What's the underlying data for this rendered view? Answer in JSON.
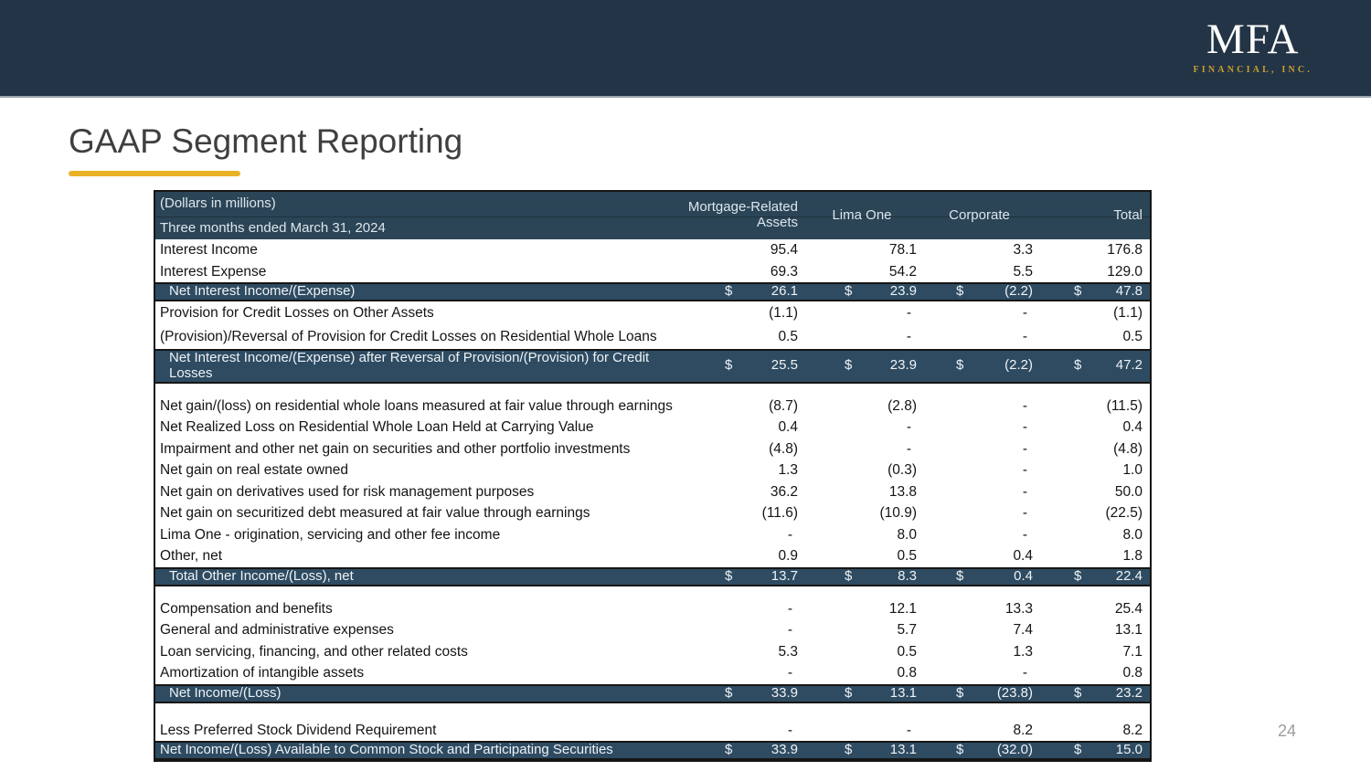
{
  "banner": {
    "logo": {
      "main": "MFA",
      "sub": "FINANCIAL, INC."
    }
  },
  "slide": {
    "title": "GAAP Segment Reporting",
    "page_number": "24"
  },
  "colors": {
    "banner_bg": "#233447",
    "table_header_bg": "#2b4557",
    "highlight_row_bg": "#2e4b61",
    "accent_gold": "#e9b125",
    "logo_gold": "#c9a02b",
    "title_text": "#3f3f3f",
    "page_number_text": "#9c9c9c"
  },
  "table": {
    "currency_symbol": "$",
    "header": {
      "label_line1": "(Dollars in millions)",
      "label_line2": "Three months ended March 31, 2024",
      "columns": [
        "Mortgage-Related Assets",
        "Lima One",
        "Corporate",
        "Total"
      ]
    },
    "rows": [
      {
        "type": "normal",
        "label": "Interest Income",
        "values": [
          "95.4",
          "78.1",
          "3.3",
          "176.8"
        ]
      },
      {
        "type": "normal",
        "label": "Interest Expense",
        "values": [
          "69.3",
          "54.2",
          "5.5",
          "129.0"
        ]
      },
      {
        "type": "highlight",
        "indent": true,
        "dollar": true,
        "label": "Net Interest Income/(Expense)",
        "values": [
          "26.1",
          "23.9",
          "(2.2)",
          "47.8"
        ]
      },
      {
        "type": "normal",
        "tall": true,
        "label": "Provision for Credit Losses on Other Assets",
        "values": [
          "(1.1)",
          "-",
          "-",
          "(1.1)"
        ]
      },
      {
        "type": "normal",
        "tall": true,
        "label": "(Provision)/Reversal of Provision for Credit Losses on Residential Whole Loans",
        "values": [
          "0.5",
          "-",
          "-",
          "0.5"
        ]
      },
      {
        "type": "highlight",
        "indent": true,
        "dollar": true,
        "label": "Net Interest Income/(Expense) after Reversal of Provision/(Provision) for Credit Losses",
        "values": [
          "25.5",
          "23.9",
          "(2.2)",
          "47.2"
        ]
      },
      {
        "type": "blank"
      },
      {
        "type": "normal",
        "label": "Net gain/(loss) on residential whole loans measured at fair value through earnings",
        "values": [
          "(8.7)",
          "(2.8)",
          "-",
          "(11.5)"
        ]
      },
      {
        "type": "normal",
        "label": "Net Realized Loss on Residential Whole Loan Held at Carrying Value",
        "values": [
          "0.4",
          "-",
          "-",
          "0.4"
        ]
      },
      {
        "type": "normal",
        "label": "Impairment and other net gain on securities and other portfolio investments",
        "values": [
          "(4.8)",
          "-",
          "-",
          "(4.8)"
        ]
      },
      {
        "type": "normal",
        "label": "Net gain on real estate owned",
        "values": [
          "1.3",
          "(0.3)",
          "-",
          "1.0"
        ]
      },
      {
        "type": "normal",
        "label": "Net gain on derivatives used for risk management purposes",
        "values": [
          "36.2",
          "13.8",
          "-",
          "50.0"
        ]
      },
      {
        "type": "normal",
        "label": "Net gain on securitized debt measured at fair value through earnings",
        "values": [
          "(11.6)",
          "(10.9)",
          "-",
          "(22.5)"
        ]
      },
      {
        "type": "normal",
        "label": "Lima One - origination, servicing and other fee income",
        "values": [
          "-",
          "8.0",
          "-",
          "8.0"
        ]
      },
      {
        "type": "normal",
        "label": "Other, net",
        "values": [
          "0.9",
          "0.5",
          "0.4",
          "1.8"
        ]
      },
      {
        "type": "highlight",
        "indent": true,
        "dollar": true,
        "label": "Total Other Income/(Loss), net",
        "values": [
          "13.7",
          "8.3",
          "0.4",
          "22.4"
        ]
      },
      {
        "type": "blank"
      },
      {
        "type": "normal",
        "label": "Compensation and benefits",
        "values": [
          "-",
          "12.1",
          "13.3",
          "25.4"
        ]
      },
      {
        "type": "normal",
        "label": "General and administrative expenses",
        "values": [
          "-",
          "5.7",
          "7.4",
          "13.1"
        ]
      },
      {
        "type": "normal",
        "label": "Loan servicing, financing, and other related costs",
        "values": [
          "5.3",
          "0.5",
          "1.3",
          "7.1"
        ]
      },
      {
        "type": "normal",
        "label": "Amortization of intangible assets",
        "values": [
          "-",
          "0.8",
          "-",
          "0.8"
        ]
      },
      {
        "type": "highlight",
        "indent": true,
        "dollar": true,
        "label": "Net Income/(Loss)",
        "values": [
          "33.9",
          "13.1",
          "(23.8)",
          "23.2"
        ]
      },
      {
        "type": "blank",
        "tall": true
      },
      {
        "type": "normal",
        "label": "Less Preferred Stock Dividend Requirement",
        "values": [
          "-",
          "-",
          "8.2",
          "8.2"
        ]
      },
      {
        "type": "highlight",
        "dollar": true,
        "label": "Net Income/(Loss) Available to Common Stock and Participating Securities",
        "values": [
          "33.9",
          "13.1",
          "(32.0)",
          "15.0"
        ]
      }
    ]
  }
}
